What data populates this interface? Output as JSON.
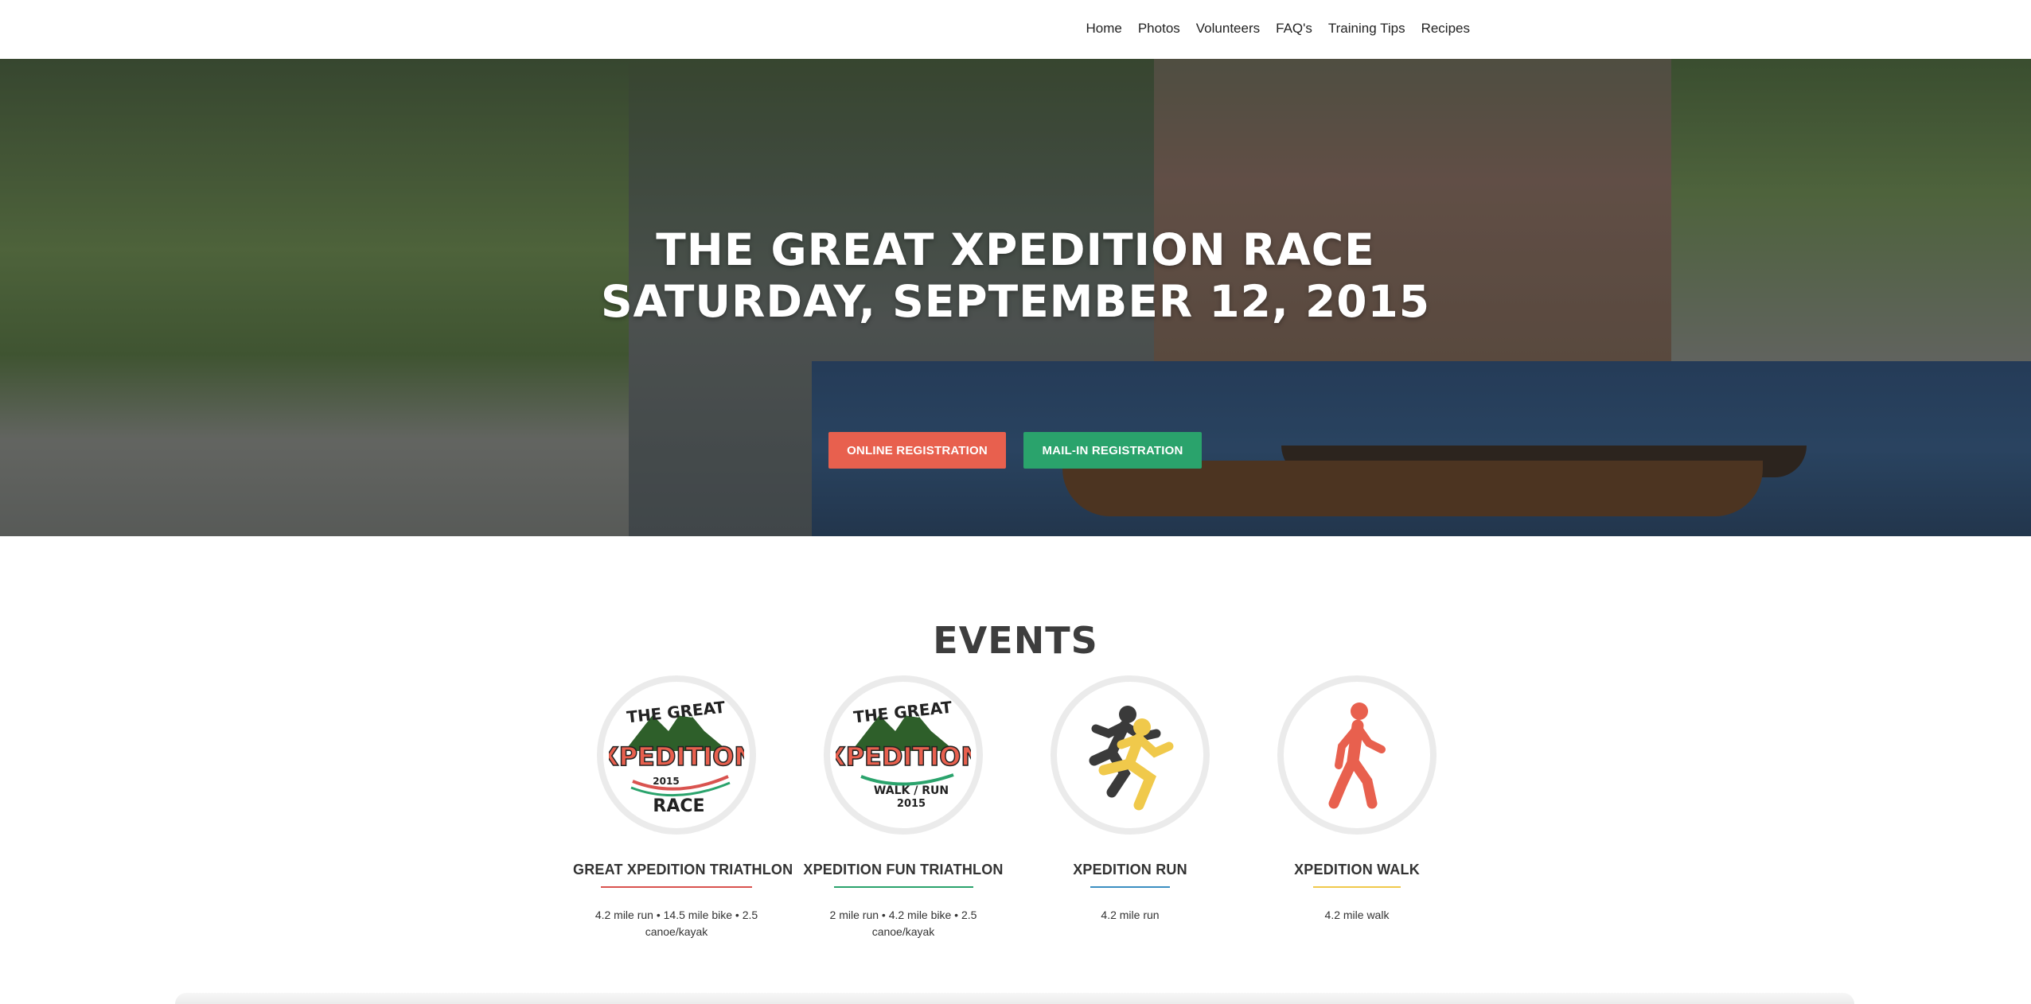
{
  "nav": {
    "items": [
      "Home",
      "Photos",
      "Volunteers",
      "FAQ's",
      "Training Tips",
      "Recipes"
    ]
  },
  "hero": {
    "title_line1": "THE GREAT XPEDITION RACE",
    "title_line2": "SATURDAY, SEPTEMBER 12, 2015",
    "online_button": "ONLINE REGISTRATION",
    "mail_button": "MAIL-IN REGISTRATION"
  },
  "colors": {
    "online": "#e8604e",
    "mail": "#2aa36c",
    "triathlon_underline": "#d9534f",
    "fun_underline": "#2aa36c",
    "run_underline": "#3b8fc2",
    "walk_underline": "#f0c94b"
  },
  "events": {
    "heading": "EVENTS",
    "items": [
      {
        "name": "GREAT XPEDITION TRIATHLON",
        "desc": "4.2 mile run • 14.5 mile bike • 2.5 canoe/kayak",
        "icon": "race-logo-icon",
        "logo_top": "THE GREAT",
        "logo_main": "XPEDITION",
        "logo_year": "2015",
        "logo_bottom": "RACE"
      },
      {
        "name": "XPEDITION FUN TRIATHLON",
        "desc": "2 mile run • 4.2 mile bike • 2.5 canoe/kayak",
        "icon": "walk-run-logo-icon",
        "logo_top": "THE GREAT",
        "logo_main": "XPEDITION",
        "logo_bottom": "WALK / RUN",
        "logo_year": "2015"
      },
      {
        "name": "XPEDITION RUN",
        "desc": "4.2 mile run",
        "icon": "runners-icon"
      },
      {
        "name": "XPEDITION WALK",
        "desc": "4.2 mile walk",
        "icon": "walker-icon"
      }
    ]
  }
}
